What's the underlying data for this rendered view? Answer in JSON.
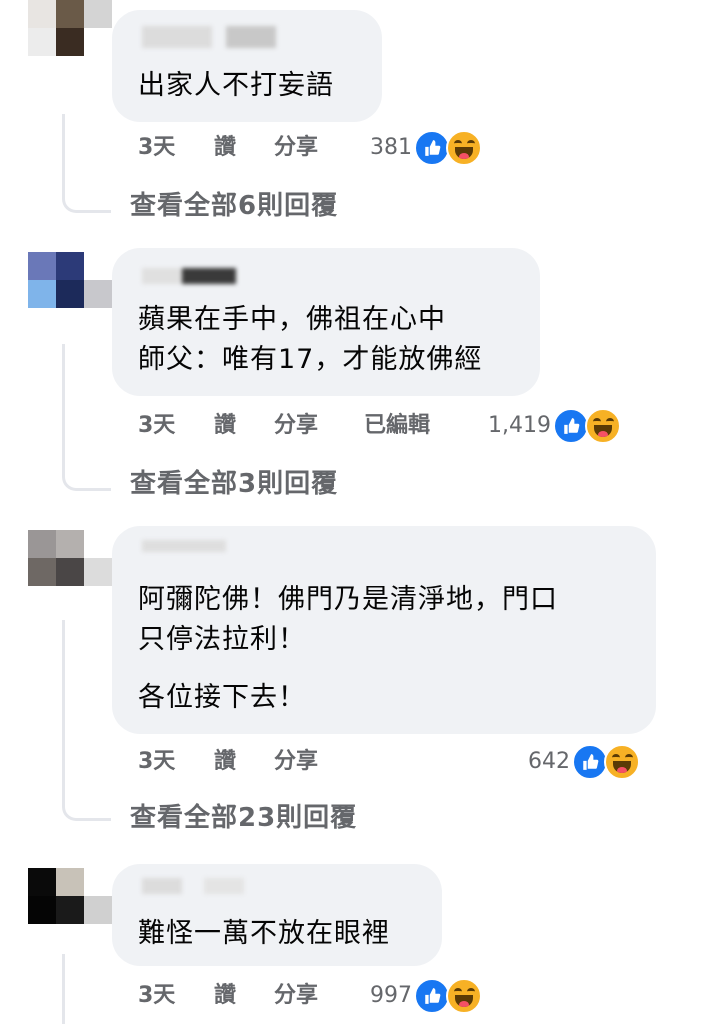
{
  "comments": [
    {
      "lines": [
        "出家人不打妄語"
      ],
      "time": "3天",
      "like": "讚",
      "share": "分享",
      "edited": "",
      "reaction_count": "381",
      "replies": "查看全部6則回覆"
    },
    {
      "lines": [
        "蘋果在手中，佛祖在心中",
        "師父：唯有17，才能放佛經"
      ],
      "time": "3天",
      "like": "讚",
      "share": "分享",
      "edited": "已編輯",
      "reaction_count": "1,419",
      "replies": "查看全部3則回覆"
    },
    {
      "lines": [
        "阿彌陀佛！佛門乃是清淨地，門口",
        "只停法拉利！",
        "各位接下去！"
      ],
      "time": "3天",
      "like": "讚",
      "share": "分享",
      "edited": "",
      "reaction_count": "642",
      "replies": "查看全部23則回覆"
    },
    {
      "lines": [
        "難怪一萬不放在眼裡"
      ],
      "time": "3天",
      "like": "讚",
      "share": "分享",
      "edited": "",
      "reaction_count": "997",
      "replies": ""
    }
  ],
  "reaction_icons": [
    "like-icon",
    "haha-icon"
  ],
  "colors": {
    "like": "#1877f2",
    "haha": "#f7b125",
    "bubble": "#f0f2f5",
    "meta": "#65676b"
  }
}
